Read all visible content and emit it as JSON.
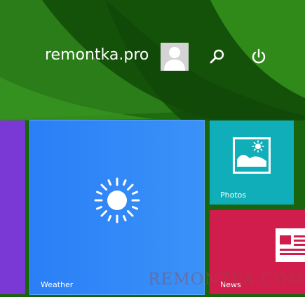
{
  "user": {
    "name": "remontka.pro"
  },
  "header": {
    "search_icon": "search-icon",
    "power_icon": "power-icon",
    "avatar_icon": "user-avatar-icon"
  },
  "tiles": {
    "weather": {
      "label": "Weather",
      "icon": "sun-icon",
      "color": "#2f86f6"
    },
    "photos": {
      "label": "Photos",
      "icon": "picture-icon",
      "color": "#10aeb8"
    },
    "news": {
      "label": "News",
      "icon": "newspaper-icon",
      "color": "#d11d4c"
    },
    "left_partial": {
      "color": "#7a39d4"
    }
  },
  "watermark": "REMONTKA.COM"
}
